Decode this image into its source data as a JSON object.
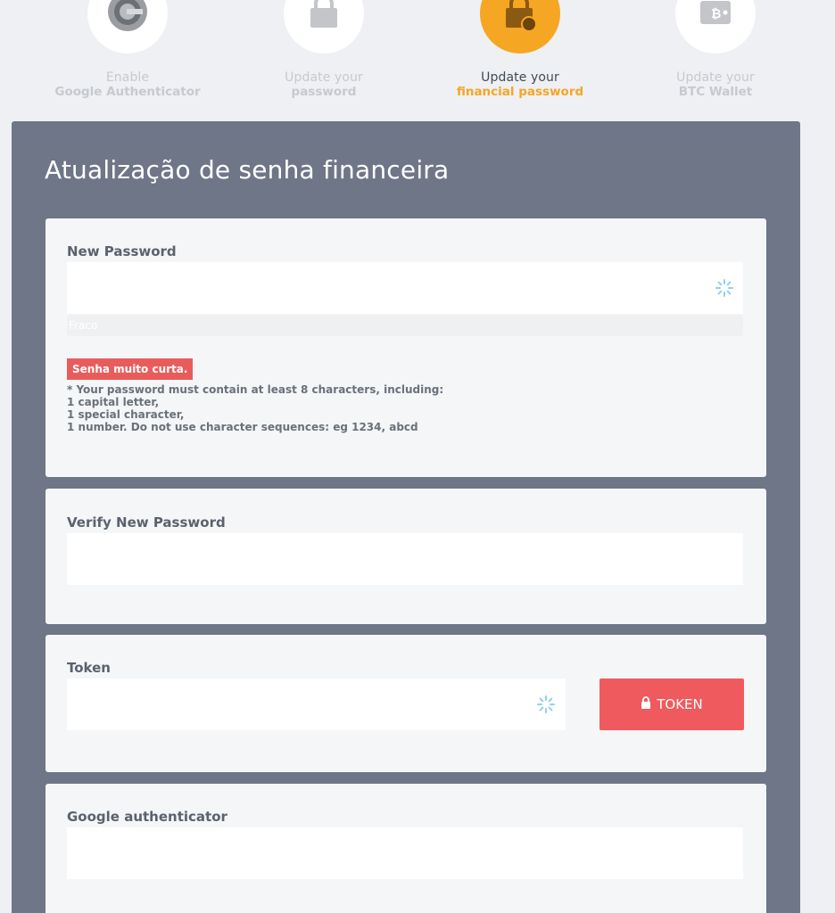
{
  "steps": [
    {
      "line1": "Enable",
      "line2": "Google Authenticator",
      "icon": "google-authenticator-icon",
      "active": false
    },
    {
      "line1": "Update your",
      "line2": "password",
      "icon": "padlock-icon",
      "active": false
    },
    {
      "line1": "Update your",
      "line2": "financial password",
      "icon": "padlock-coin-icon",
      "active": true
    },
    {
      "line1": "Update your",
      "line2": "BTC Wallet",
      "icon": "bitcoin-wallet-icon",
      "active": false
    }
  ],
  "colors": {
    "accent": "#f5a623",
    "panel": "#6e7687",
    "danger": "#ee5a5d",
    "error_badge": "#e85c5c"
  },
  "panel": {
    "title": "Atualização de senha financeira"
  },
  "new_password": {
    "label": "New Password",
    "value": "",
    "strength_text": "Fraco",
    "error": "Senha muito curta.",
    "hint": [
      "* Your password must contain at least 8 characters, including:",
      "1 capital letter,",
      "1 special character,",
      "1 number. Do not use character sequences: eg 1234, abcd"
    ]
  },
  "verify_password": {
    "label": "Verify New Password",
    "value": ""
  },
  "token": {
    "label": "Token",
    "value": "",
    "button_label": "TOKEN"
  },
  "google_auth": {
    "label": "Google authenticator",
    "value": ""
  }
}
